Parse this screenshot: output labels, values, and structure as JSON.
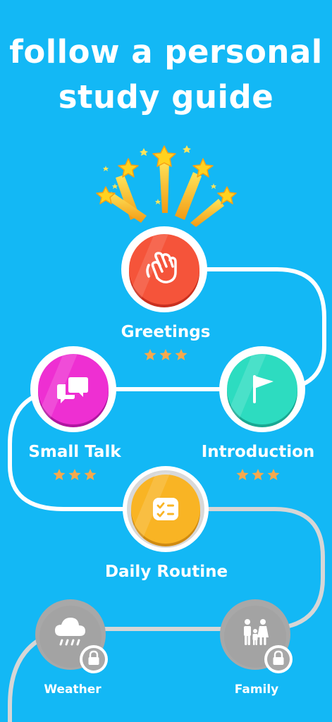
{
  "header": {
    "line1": "follow a personal",
    "line2": "study guide"
  },
  "colors": {
    "background": "#13b8f5",
    "path": "#ffffff",
    "path_locked": "#d6d6d6",
    "star_rating": "#f6a94d",
    "greetings": "#f5543a",
    "small_talk": "#ee2fd2",
    "introduction": "#2ddcc0",
    "daily_routine": "#f9b424",
    "locked": "#a8a8a8"
  },
  "lessons": [
    {
      "id": "greetings",
      "label": "Greetings",
      "icon": "waving-hand-icon",
      "stars": 3,
      "locked": false
    },
    {
      "id": "small_talk",
      "label": "Small Talk",
      "icon": "chat-bubbles-icon",
      "stars": 3,
      "locked": false
    },
    {
      "id": "introduction",
      "label": "Introduction",
      "icon": "flag-icon",
      "stars": 3,
      "locked": false
    },
    {
      "id": "daily_routine",
      "label": "Daily Routine",
      "icon": "checklist-icon",
      "stars": 0,
      "locked": false
    },
    {
      "id": "weather",
      "label": "Weather",
      "icon": "rain-cloud-icon",
      "stars": 0,
      "locked": true
    },
    {
      "id": "family",
      "label": "Family",
      "icon": "family-icon",
      "stars": 0,
      "locked": true
    }
  ]
}
